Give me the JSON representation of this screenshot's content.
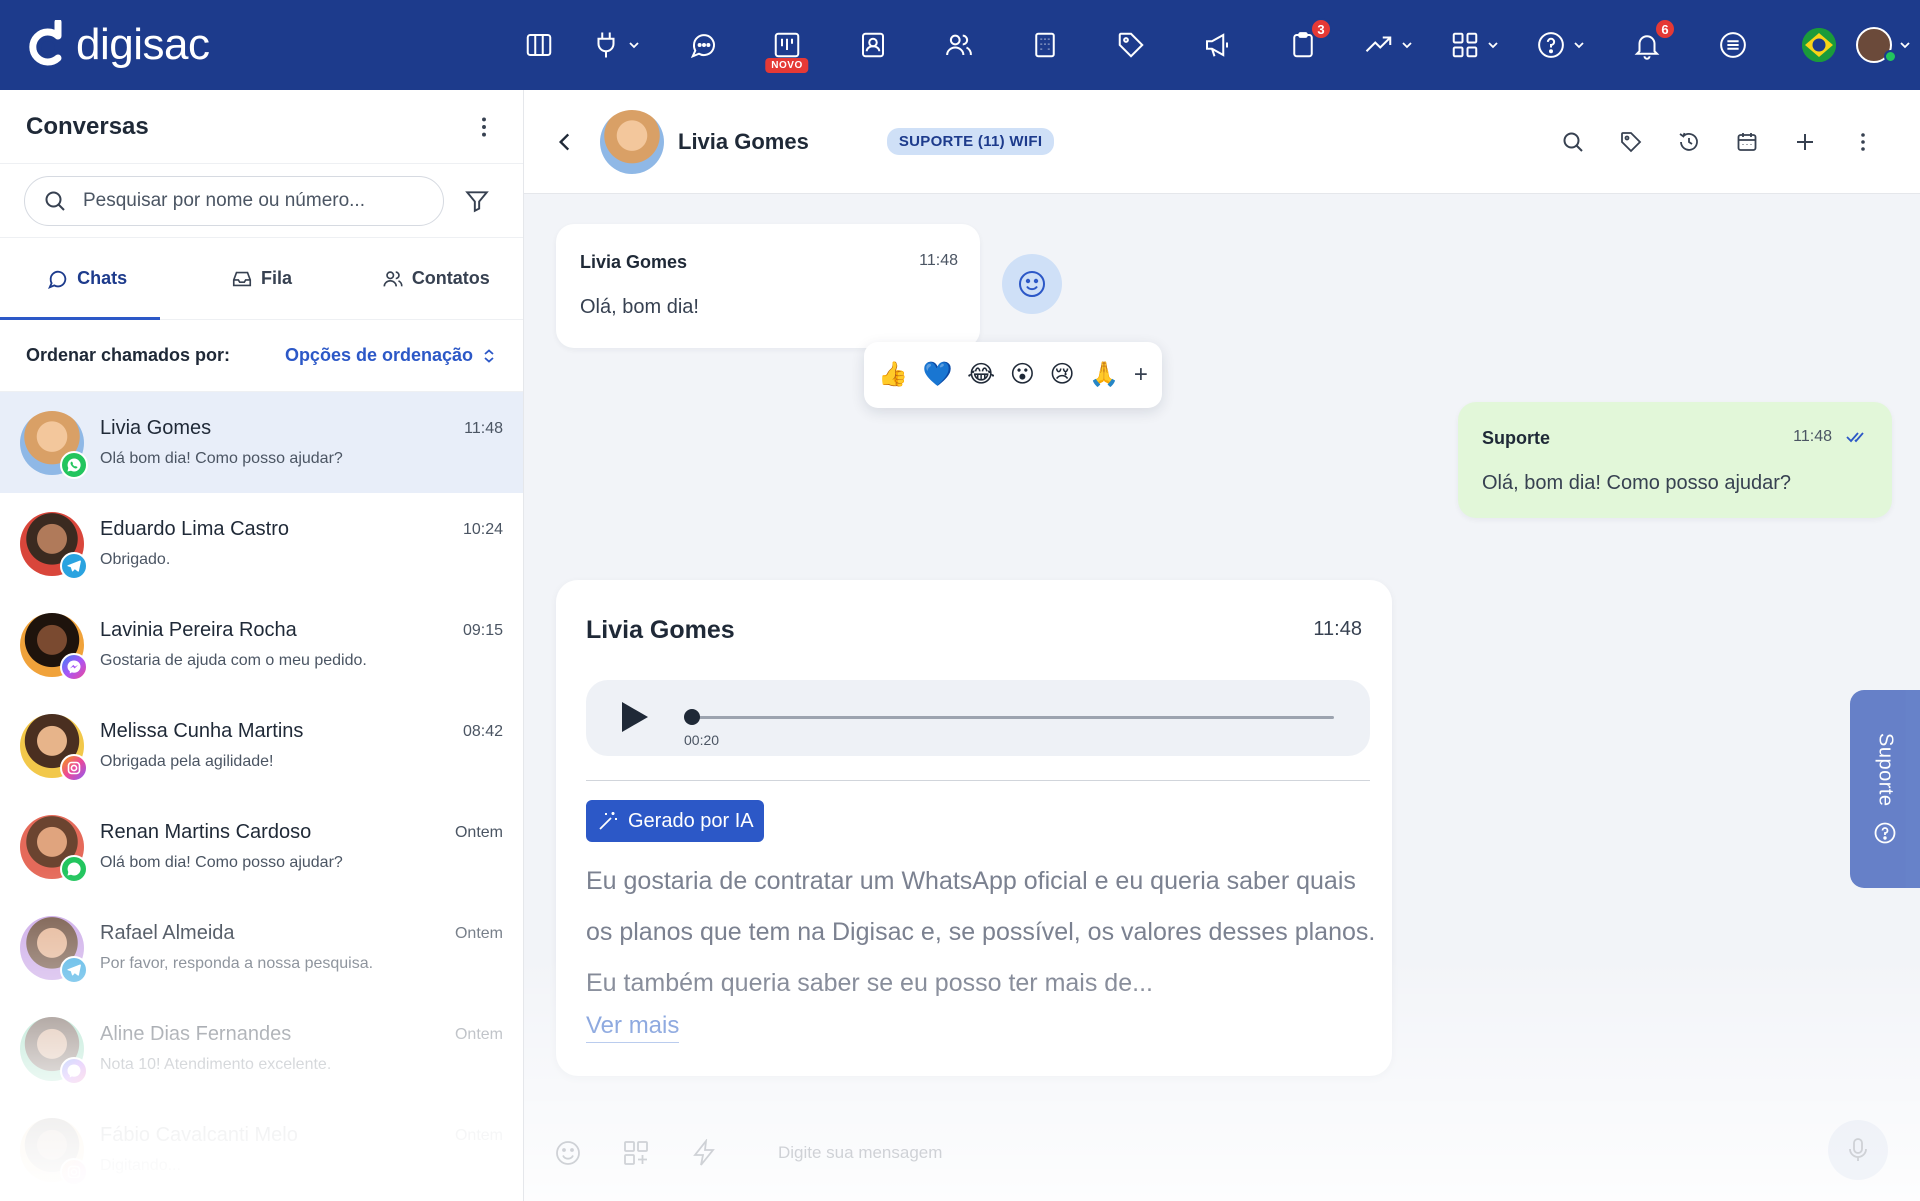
{
  "brand": {
    "logo_text": "digisac"
  },
  "topbar": {
    "icons": [
      {
        "name": "columns-icon",
        "chevron": false
      },
      {
        "name": "plug-icon",
        "chevron": true
      },
      {
        "name": "chat-icon",
        "chevron": false
      },
      {
        "name": "kanban-icon",
        "chevron": false,
        "tag": "NOVO"
      },
      {
        "name": "contact-book-icon",
        "chevron": false
      },
      {
        "name": "users-icon",
        "chevron": false
      },
      {
        "name": "building-icon",
        "chevron": false
      },
      {
        "name": "tag-icon",
        "chevron": false
      },
      {
        "name": "megaphone-icon",
        "chevron": false
      },
      {
        "name": "clipboard-icon",
        "chevron": false,
        "badge": "3"
      },
      {
        "name": "trend-icon",
        "chevron": true
      },
      {
        "name": "apps-grid-icon",
        "chevron": true
      },
      {
        "name": "help-icon",
        "chevron": true
      },
      {
        "name": "bell-icon",
        "chevron": false,
        "badge": "6"
      },
      {
        "name": "menu-lines-icon",
        "chevron": false
      }
    ],
    "novo_label": "NOVO",
    "clipboard_badge": "3",
    "bell_badge": "6"
  },
  "left": {
    "title": "Conversas",
    "search_placeholder": "Pesquisar por nome ou número...",
    "tabs": [
      {
        "label": "Chats",
        "icon": "chat-bubble-icon"
      },
      {
        "label": "Fila",
        "icon": "inbox-icon"
      },
      {
        "label": "Contatos",
        "icon": "contacts-icon"
      }
    ],
    "sort_label": "Ordenar chamados por:",
    "sort_options": "Opções de ordenação",
    "chats": [
      {
        "name": "Livia Gomes",
        "time": "11:48",
        "preview": "Olá bom dia! Como posso ajudar?",
        "channel": "whatsapp",
        "color": "#e0a36b"
      },
      {
        "name": "Eduardo Lima Castro",
        "time": "10:24",
        "preview": "Obrigado.",
        "channel": "telegram",
        "color": "#7a4a36"
      },
      {
        "name": "Lavinia Pereira Rocha",
        "time": "09:15",
        "preview": "Gostaria de ajuda com o meu pedido.",
        "channel": "messenger",
        "color": "#3b2417"
      },
      {
        "name": "Melissa Cunha Martins",
        "time": "08:42",
        "preview": "Obrigada pela agilidade!",
        "channel": "instagram",
        "color": "#c98a5a"
      },
      {
        "name": "Renan Martins Cardoso",
        "time": "Ontem",
        "preview": "Olá bom dia! Como posso ajudar?",
        "channel": "whatsapp",
        "color": "#d89a7a"
      },
      {
        "name": "Rafael Almeida",
        "time": "Ontem",
        "preview": "Por favor, responda a nossa pesquisa.",
        "channel": "telegram",
        "color": "#b98a6a"
      },
      {
        "name": "Aline Dias Fernandes",
        "time": "Ontem",
        "preview": "Nota 10! Atendimento excelente.",
        "channel": "messenger",
        "color": "#8a6a5a"
      },
      {
        "name": "Fábio Cavalcanti Melo",
        "time": "Ontem",
        "preview": "Digitando...",
        "channel": "instagram",
        "color": "#6a5040"
      }
    ]
  },
  "conversation": {
    "contact_name": "Livia Gomes",
    "queue_badge": "SUPORTE (11) WIFI",
    "messages": {
      "incoming_1": {
        "sender": "Livia Gomes",
        "time": "11:48",
        "text": "Olá, bom dia!"
      },
      "reactions": [
        "👍",
        "💙",
        "😂",
        "😮",
        "😢",
        "🙏"
      ],
      "reaction_more": "+",
      "outgoing_1": {
        "sender": "Suporte",
        "time": "11:48",
        "text": "Olá, bom dia! Como posso ajudar?"
      },
      "audio": {
        "sender": "Livia Gomes",
        "time": "11:48",
        "duration": "00:20",
        "progress": 0.0,
        "ai_label": "Gerado por IA",
        "transcript": "Eu gostaria de contratar um WhatsApp oficial e eu queria saber quais os planos que tem na Digisac e, se possível, os valores desses planos. Eu também queria saber se eu posso ter mais de...",
        "ver_mais": "Ver mais"
      }
    },
    "support_tab": "Suporte",
    "composer_placeholder": "Digite sua mensagem"
  },
  "colors": {
    "brand": "#1d3b8c",
    "accent": "#2c58c7",
    "own_bubble": "#e2f7d9"
  }
}
